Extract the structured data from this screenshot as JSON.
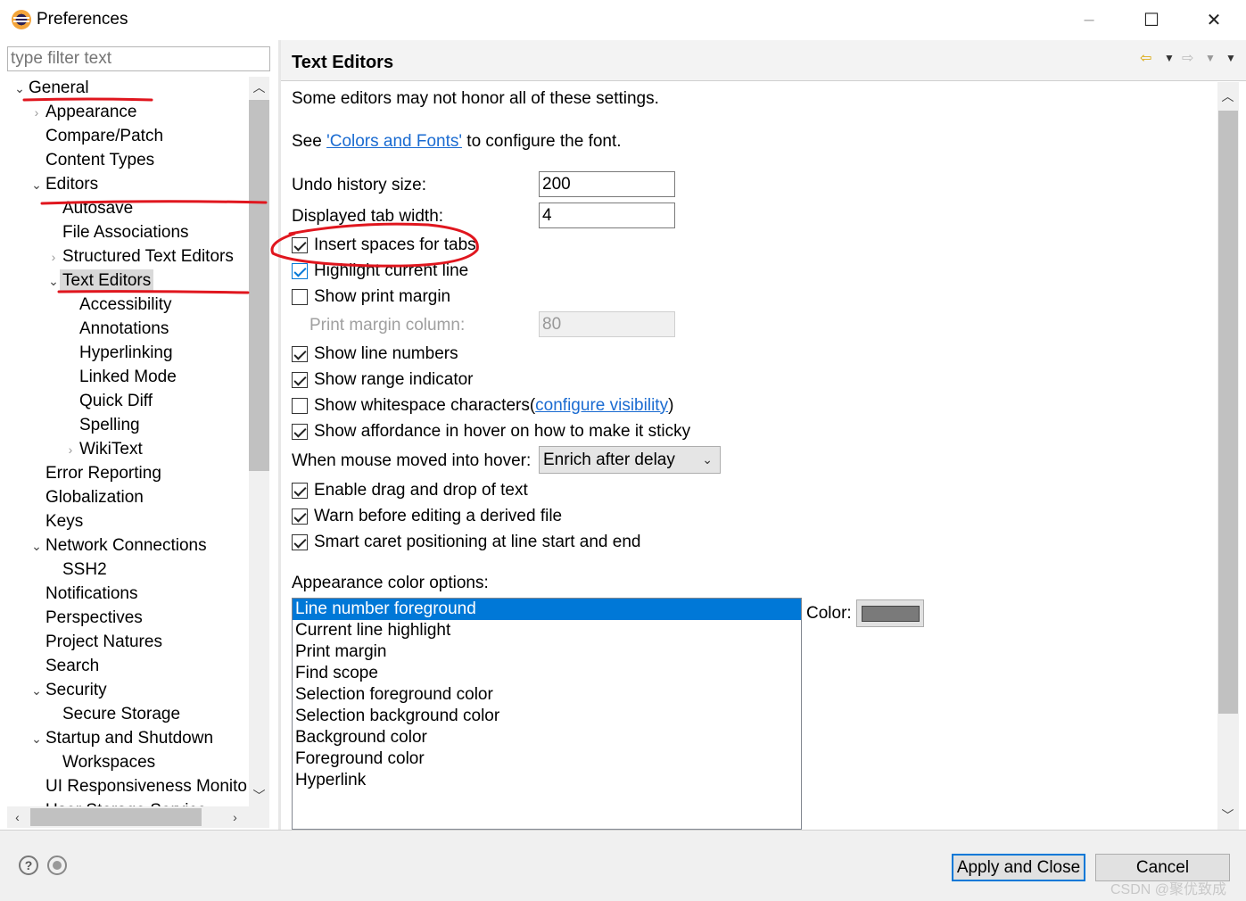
{
  "window": {
    "title": "Preferences",
    "minimize_icon": "–",
    "maximize_icon": "☐",
    "close_icon": "✕"
  },
  "filter": {
    "placeholder": "type filter text"
  },
  "tree": {
    "items": [
      {
        "label": "General",
        "expanded": true
      },
      {
        "label": "Appearance",
        "expanded": false
      },
      {
        "label": "Compare/Patch"
      },
      {
        "label": "Content Types"
      },
      {
        "label": "Editors",
        "expanded": true
      },
      {
        "label": "Autosave"
      },
      {
        "label": "File Associations"
      },
      {
        "label": "Structured Text Editors",
        "expanded": false
      },
      {
        "label": "Text Editors",
        "expanded": true,
        "selected": true
      },
      {
        "label": "Accessibility"
      },
      {
        "label": "Annotations"
      },
      {
        "label": "Hyperlinking"
      },
      {
        "label": "Linked Mode"
      },
      {
        "label": "Quick Diff"
      },
      {
        "label": "Spelling"
      },
      {
        "label": "WikiText",
        "expanded": false
      },
      {
        "label": "Error Reporting"
      },
      {
        "label": "Globalization"
      },
      {
        "label": "Keys"
      },
      {
        "label": "Network Connections",
        "expanded": true
      },
      {
        "label": "SSH2"
      },
      {
        "label": "Notifications"
      },
      {
        "label": "Perspectives"
      },
      {
        "label": "Project Natures"
      },
      {
        "label": "Search"
      },
      {
        "label": "Security",
        "expanded": true
      },
      {
        "label": "Secure Storage"
      },
      {
        "label": "Startup and Shutdown",
        "expanded": true
      },
      {
        "label": "Workspaces"
      },
      {
        "label": "UI Responsiveness Monitoring"
      },
      {
        "label": "User Storage Service"
      }
    ]
  },
  "page": {
    "title": "Text Editors",
    "intro": "Some editors may not honor all of these settings.",
    "font_see": "See ",
    "font_link": "'Colors and Fonts'",
    "font_rest": " to configure the font.",
    "undo_label": "Undo history size:",
    "undo_value": "200",
    "tab_width_label": "Displayed tab width:",
    "tab_width_value": "4",
    "insert_spaces": "Insert spaces for tabs",
    "highlight_line": "Highlight current line",
    "show_print_margin": "Show print margin",
    "print_margin_label": "Print margin column:",
    "print_margin_value": "80",
    "show_line_numbers": "Show line numbers",
    "show_range": "Show range indicator",
    "show_whitespace": "Show whitespace characters ",
    "whitespace_paren_open": "(",
    "whitespace_link": "configure visibility",
    "whitespace_paren_close": ")",
    "show_affordance": "Show affordance in hover on how to make it sticky",
    "hover_label": "When mouse moved into hover:",
    "hover_value": "Enrich after delay",
    "drag_drop": "Enable drag and drop of text",
    "warn_derived": "Warn before editing a derived file",
    "smart_caret": "Smart caret positioning at line start and end",
    "appearance_label": "Appearance color options:",
    "color_label": "Color:",
    "color_value": "#7a7a7a",
    "color_options": [
      "Line number foreground",
      "Current line highlight",
      "Print margin",
      "Find scope",
      "Selection foreground color",
      "Selection background color",
      "Background color",
      "Foreground color",
      "Hyperlink"
    ]
  },
  "buttons": {
    "apply_close": "Apply and Close",
    "cancel": "Cancel"
  },
  "watermark": "CSDN @聚优致成",
  "colors": {
    "selection": "#0078d7",
    "link": "#1a6bd1",
    "annotation": "#e0161e"
  }
}
